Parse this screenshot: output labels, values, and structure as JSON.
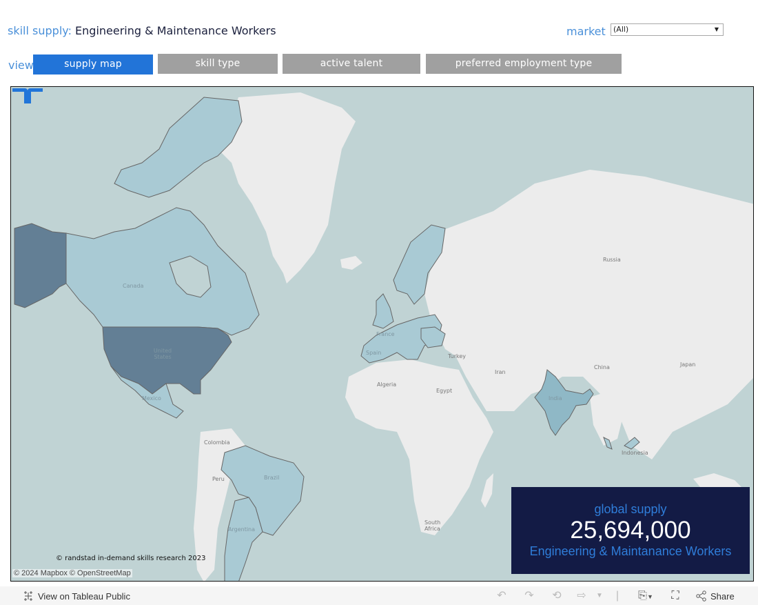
{
  "header": {
    "title_label": "skill supply:",
    "title_value": "Engineering & Maintenance Workers",
    "market_label": "market",
    "market_selected": "(All)"
  },
  "view": {
    "label": "view",
    "tabs": [
      {
        "label": "supply map",
        "active": true
      },
      {
        "label": "skill type",
        "active": false
      },
      {
        "label": "active talent",
        "active": false
      },
      {
        "label": "preferred employment type",
        "active": false
      }
    ]
  },
  "map": {
    "labels": {
      "canada": "Canada",
      "united_states": "United States",
      "mexico": "Mexico",
      "colombia": "Colombia",
      "peru": "Peru",
      "brazil": "Brazil",
      "argentina": "Argentina",
      "france": "France",
      "spain": "Spain",
      "algeria": "Algeria",
      "egypt": "Egypt",
      "turkey": "Turkey",
      "iran": "Iran",
      "russia": "Russia",
      "china": "China",
      "japan": "Japan",
      "india": "India",
      "indonesia": "Indonesia",
      "south_africa": "South Africa"
    },
    "legend_colors": {
      "ocean": "#c0d3d4",
      "land_no_data": "#ececec",
      "supply_low": "#a9cad4",
      "supply_mid": "#8fb8c6",
      "supply_high": "#637f95",
      "border": "#666666"
    },
    "highlighted_markets": [
      "United States",
      "Alaska (US)",
      "Canada",
      "Mexico",
      "Brazil",
      "Argentina",
      "United Kingdom",
      "Ireland",
      "France",
      "Spain",
      "Portugal",
      "Italy",
      "Germany",
      "Poland",
      "Netherlands",
      "Belgium",
      "Switzerland",
      "Austria",
      "Czech Republic",
      "Hungary",
      "Romania",
      "Norway",
      "Sweden",
      "India",
      "Malaysia"
    ],
    "brand_text": "© randstad in-demand skills research 2023",
    "attribution": "© 2024 Mapbox  © OpenStreetMap"
  },
  "supply_box": {
    "heading": "global supply",
    "value": "25,694,000",
    "subtitle": "Engineering & Maintanance Workers"
  },
  "footer": {
    "view_on_tableau": "View on Tableau Public",
    "share": "Share"
  }
}
